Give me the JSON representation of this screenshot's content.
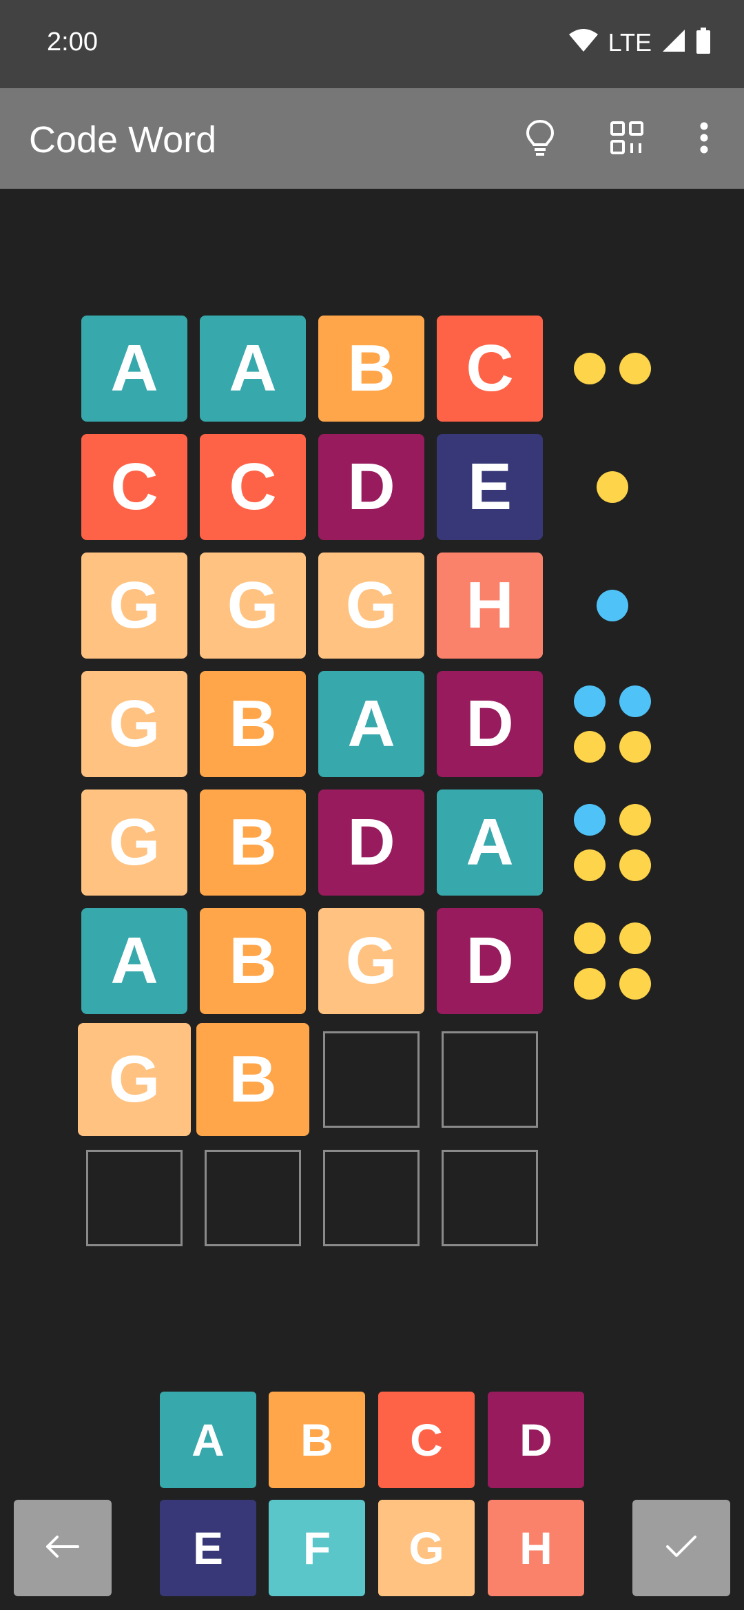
{
  "status_bar": {
    "time": "2:00",
    "network": "LTE"
  },
  "app_bar": {
    "title": "Code Word"
  },
  "colors": {
    "A": "#37a8ab",
    "B": "#ffa64a",
    "C": "#ff6347",
    "D": "#981b5e",
    "E": "#383878",
    "F": "#5bc6c9",
    "G": "#ffc280",
    "H": "#fa826b",
    "peg_yellow": "#fdd44a",
    "peg_blue": "#4fc3f7"
  },
  "guesses": [
    {
      "letters": [
        "A",
        "A",
        "B",
        "C"
      ],
      "feedback": [
        "yellow",
        "yellow"
      ]
    },
    {
      "letters": [
        "C",
        "C",
        "D",
        "E"
      ],
      "feedback": [
        "yellow"
      ]
    },
    {
      "letters": [
        "G",
        "G",
        "G",
        "H"
      ],
      "feedback": [
        "blue"
      ]
    },
    {
      "letters": [
        "G",
        "B",
        "A",
        "D"
      ],
      "feedback": [
        "blue",
        "blue",
        "yellow",
        "yellow"
      ]
    },
    {
      "letters": [
        "G",
        "B",
        "D",
        "A"
      ],
      "feedback": [
        "blue",
        "yellow",
        "yellow",
        "yellow"
      ]
    },
    {
      "letters": [
        "A",
        "B",
        "G",
        "D"
      ],
      "feedback": [
        "yellow",
        "yellow",
        "yellow",
        "yellow"
      ]
    },
    {
      "letters": [
        "G",
        "B",
        "",
        ""
      ],
      "feedback": []
    },
    {
      "letters": [
        "",
        "",
        "",
        ""
      ],
      "feedback": []
    }
  ],
  "keyboard": {
    "row1": [
      "A",
      "B",
      "C",
      "D"
    ],
    "row2": [
      "E",
      "F",
      "G",
      "H"
    ]
  }
}
